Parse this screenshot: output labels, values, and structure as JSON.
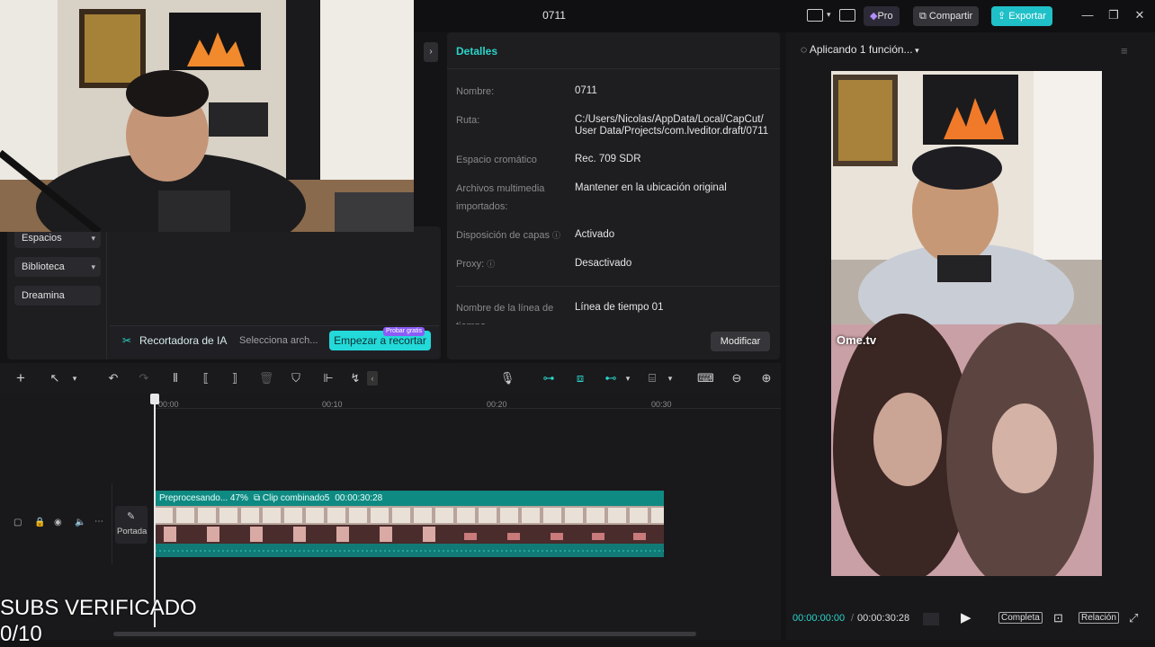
{
  "window": {
    "title": "0711",
    "pro_label": "Pro",
    "share_label": "Compartir",
    "export_label": "Exportar"
  },
  "left_panel": {
    "items": [
      {
        "label": "Espacios"
      },
      {
        "label": "Biblioteca"
      },
      {
        "label": "Dreamina"
      }
    ],
    "ai_cutter": {
      "title": "Recortadora de IA",
      "select_placeholder": "Selecciona arch...",
      "start_button": "Empezar a recortar",
      "badge": "Probar gratis"
    }
  },
  "details": {
    "header": "Detalles",
    "rows": [
      {
        "label": "Nombre:",
        "value": "0711"
      },
      {
        "label": "Ruta:",
        "value": "C:/Users/Nicolas/AppData/Local/CapCut/ User Data/Projects/com.lveditor.draft/0711"
      },
      {
        "label": "Espacio cromático",
        "value": "Rec. 709 SDR"
      },
      {
        "label": "Archivos multimedia importados:",
        "value": "Mantener en la ubicación original"
      },
      {
        "label": "Disposición de capas",
        "value": "Activado"
      },
      {
        "label": "Proxy:",
        "value": "Desactivado"
      },
      {
        "label": "Nombre de la línea de tiempo",
        "value": "Línea de tiempo 01"
      }
    ],
    "modify_button": "Modificar"
  },
  "preview": {
    "status": "Aplicando 1 función...",
    "overlay_logo": "Ome.tv",
    "current_time": "00:00:00:00",
    "total_time": "00:00:30:28",
    "full_label": "Completa",
    "ratio_label": "Relación"
  },
  "timeline": {
    "ruler": [
      "00:00",
      "00:10",
      "00:20",
      "00:30"
    ],
    "clip_status": "Preprocesando... 47%",
    "clip_name": "Clip combinado5",
    "clip_duration": "00:00:30:28",
    "cover_label": "Portada"
  },
  "overlay": {
    "line1": "SUBS VERIFICADO",
    "line2": "0/10"
  },
  "colors": {
    "accent": "#20c0c8",
    "clip": "#0f8a82"
  }
}
